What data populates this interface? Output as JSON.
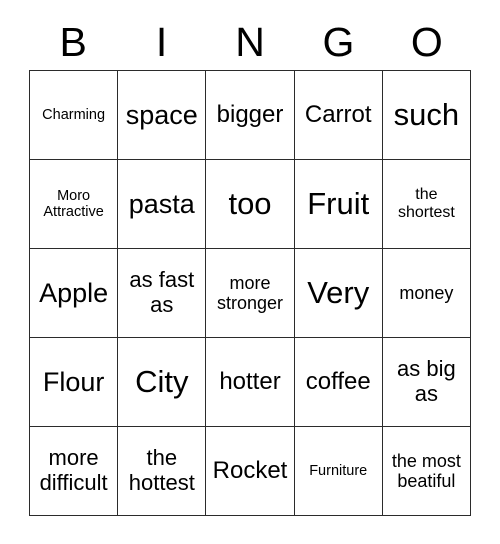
{
  "card": {
    "header_letters": [
      "B",
      "I",
      "N",
      "G",
      "O"
    ],
    "rows": [
      [
        {
          "text": "Charming",
          "size": "xxs"
        },
        {
          "text": "space",
          "size": "xl"
        },
        {
          "text": "bigger",
          "size": "lg"
        },
        {
          "text": "Carrot",
          "size": "lg"
        },
        {
          "text": "such",
          "size": "xxl"
        }
      ],
      [
        {
          "text": "Moro Attractive",
          "size": "xxs"
        },
        {
          "text": "pasta",
          "size": "xl"
        },
        {
          "text": "too",
          "size": "xxl"
        },
        {
          "text": "Fruit",
          "size": "xxl"
        },
        {
          "text": "the shortest",
          "size": "xs"
        }
      ],
      [
        {
          "text": "Apple",
          "size": "xl"
        },
        {
          "text": "as fast as",
          "size": "md"
        },
        {
          "text": "more stronger",
          "size": "sm"
        },
        {
          "text": "Very",
          "size": "xxl"
        },
        {
          "text": "money",
          "size": "sm"
        }
      ],
      [
        {
          "text": "Flour",
          "size": "xl"
        },
        {
          "text": "City",
          "size": "xxl"
        },
        {
          "text": "hotter",
          "size": "lg"
        },
        {
          "text": "coffee",
          "size": "lg"
        },
        {
          "text": "as big as",
          "size": "md"
        }
      ],
      [
        {
          "text": "more difficult",
          "size": "md"
        },
        {
          "text": "the hottest",
          "size": "md"
        },
        {
          "text": "Rocket",
          "size": "lg"
        },
        {
          "text": "Furniture",
          "size": "xxs"
        },
        {
          "text": "the most beatiful",
          "size": "sm"
        }
      ]
    ],
    "colors": {
      "text": "#000000",
      "border": "#2b2b2b",
      "background": "#ffffff"
    }
  }
}
